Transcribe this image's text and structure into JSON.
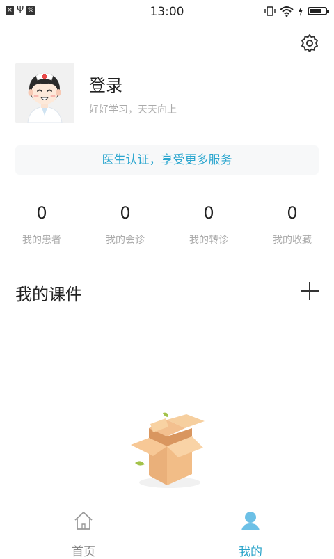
{
  "status_bar": {
    "time": "13:00",
    "left_icons": [
      "sim-off-icon",
      "usb-icon",
      "notification-icon"
    ],
    "right_icons": [
      "vibrate-icon",
      "wifi-icon",
      "charging-icon",
      "battery-icon"
    ],
    "battery_level": 0.75
  },
  "profile": {
    "avatar": "doctor-avatar",
    "login_label": "登录",
    "motto": "好好学习，天天向上"
  },
  "certification": {
    "label": "医生认证，享受更多服务",
    "color": "#2ba6cf"
  },
  "stats": [
    {
      "value": "0",
      "label": "我的患者"
    },
    {
      "value": "0",
      "label": "我的会诊"
    },
    {
      "value": "0",
      "label": "我的转诊"
    },
    {
      "value": "0",
      "label": "我的收藏"
    }
  ],
  "courseware": {
    "title": "我的课件",
    "add_icon": "plus-icon",
    "empty_icon": "empty-box-icon"
  },
  "tabbar": {
    "tabs": [
      {
        "label": "首页",
        "icon": "home-icon",
        "active": false
      },
      {
        "label": "我的",
        "icon": "user-icon",
        "active": true
      }
    ],
    "active_color": "#29a3c9",
    "inactive_color": "#888888"
  }
}
